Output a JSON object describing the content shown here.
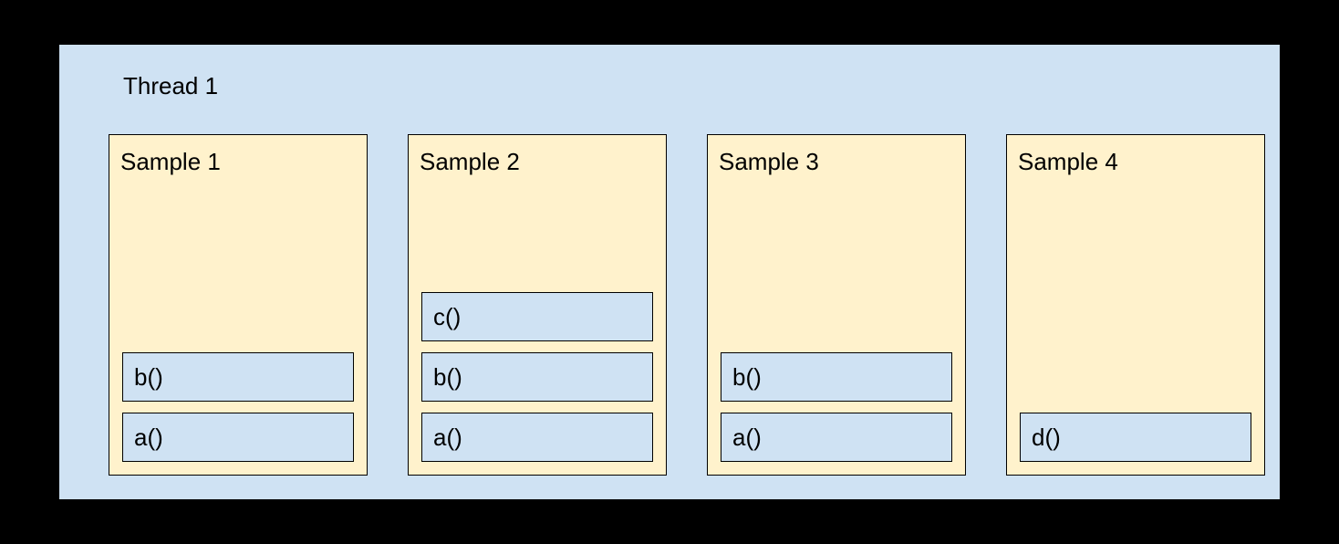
{
  "thread": {
    "title": "Thread 1",
    "samples": [
      {
        "title": "Sample 1",
        "frames": [
          "a()",
          "b()"
        ]
      },
      {
        "title": "Sample 2",
        "frames": [
          "a()",
          "b()",
          "c()"
        ]
      },
      {
        "title": "Sample 3",
        "frames": [
          "a()",
          "b()"
        ]
      },
      {
        "title": "Sample 4",
        "frames": [
          "d()"
        ]
      }
    ]
  }
}
